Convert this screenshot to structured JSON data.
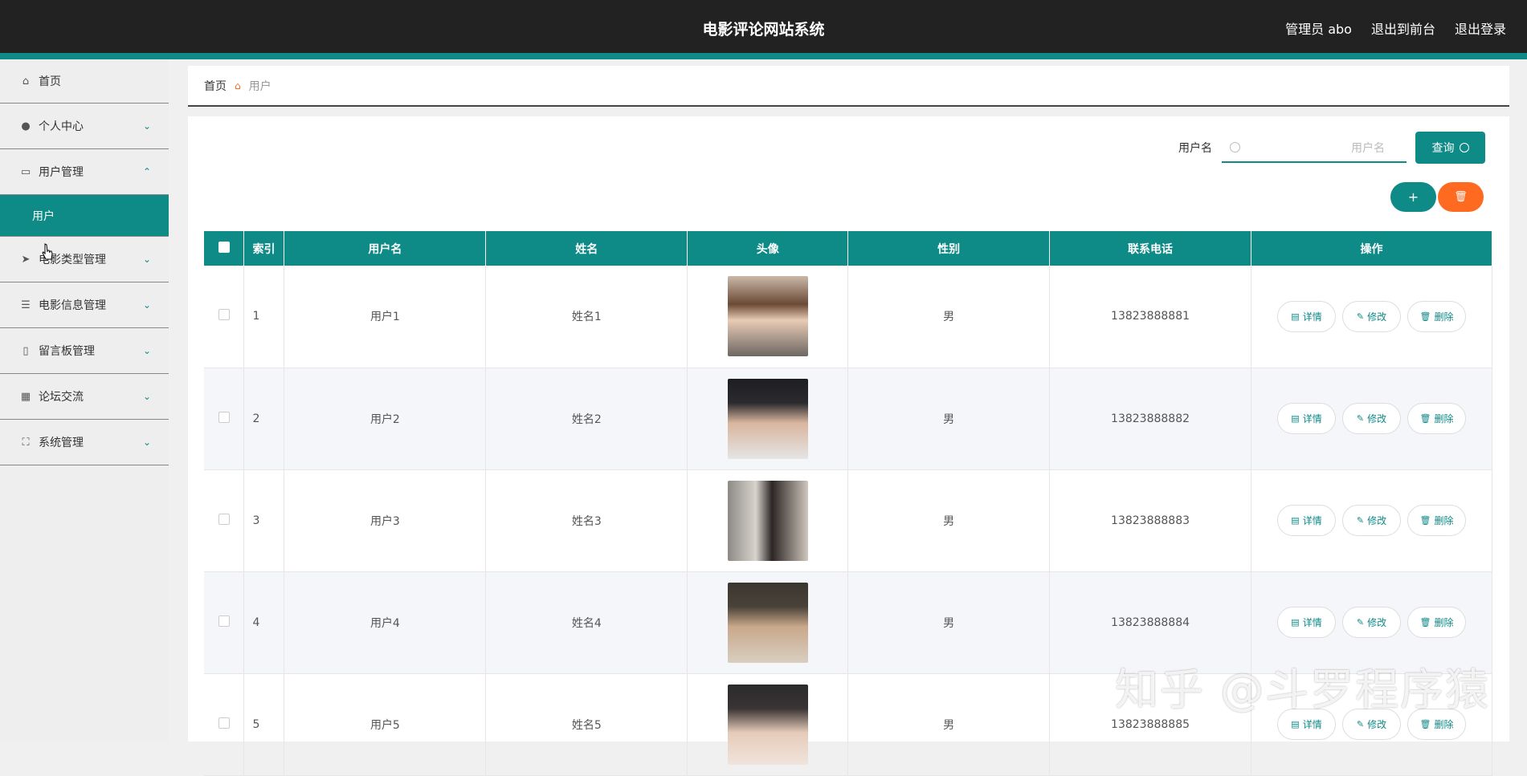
{
  "header": {
    "title": "电影评论网站系统",
    "admin": "管理员 abo",
    "to_front": "退出到前台",
    "logout": "退出登录"
  },
  "sidebar": {
    "items": [
      {
        "label": "首页",
        "icon": "home-icon"
      },
      {
        "label": "个人中心",
        "icon": "user-icon"
      },
      {
        "label": "用户管理",
        "icon": "chat-icon"
      },
      {
        "label": "用户",
        "icon": ""
      },
      {
        "label": "电影类型管理",
        "icon": "paper-plane-icon"
      },
      {
        "label": "电影信息管理",
        "icon": "list-icon"
      },
      {
        "label": "留言板管理",
        "icon": "microphone-icon"
      },
      {
        "label": "论坛交流",
        "icon": "grid-icon"
      },
      {
        "label": "系统管理",
        "icon": "fullscreen-icon"
      }
    ]
  },
  "breadcrumb": {
    "home": "首页",
    "current": "用户"
  },
  "search": {
    "label": "用户名",
    "placeholder": "用户名",
    "button": "查询"
  },
  "actions": {
    "add": "+",
    "delete": "🗑"
  },
  "table": {
    "headers": [
      "索引",
      "用户名",
      "姓名",
      "头像",
      "性别",
      "联系电话",
      "操作"
    ],
    "rows": [
      {
        "index": "1",
        "username": "用户1",
        "name": "姓名1",
        "gender": "男",
        "phone": "13823888881"
      },
      {
        "index": "2",
        "username": "用户2",
        "name": "姓名2",
        "gender": "男",
        "phone": "13823888882"
      },
      {
        "index": "3",
        "username": "用户3",
        "name": "姓名3",
        "gender": "男",
        "phone": "13823888883"
      },
      {
        "index": "4",
        "username": "用户4",
        "name": "姓名4",
        "gender": "男",
        "phone": "13823888884"
      },
      {
        "index": "5",
        "username": "用户5",
        "name": "姓名5",
        "gender": "男",
        "phone": "13823888885"
      }
    ],
    "ops": {
      "detail": "详情",
      "edit": "修改",
      "delete": "删除"
    }
  },
  "watermark": "知乎 @斗罗程序猿",
  "colors": {
    "accent": "#0e8a87",
    "danger": "#ff6a21",
    "topbar": "#222222"
  }
}
